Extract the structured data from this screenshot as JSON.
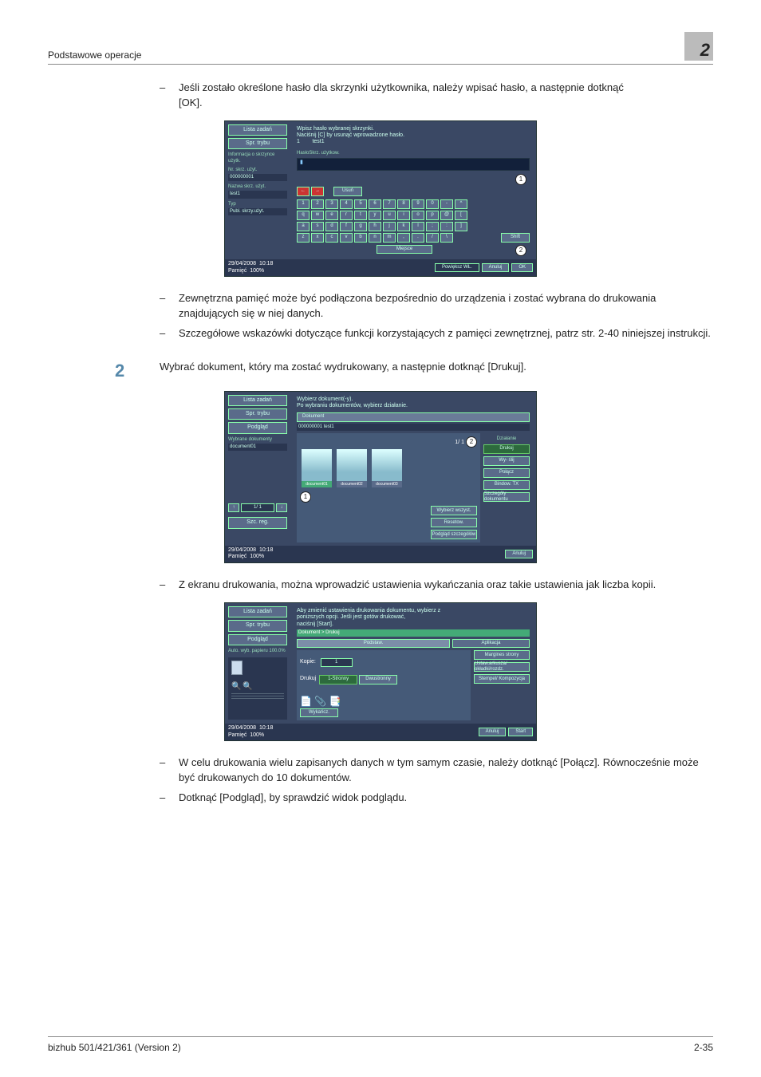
{
  "header": {
    "left": "Podstawowe operacje",
    "right": "2"
  },
  "footer": {
    "left": "bizhub 501/421/361 (Version 2)",
    "right": "2-35"
  },
  "p1_bullet1_a": "Jeśli zostało określone hasło dla skrzynki użytkownika, należy wpisać hasło, a następnie dotknąć",
  "p1_bullet1_b": "[OK].",
  "p1_bullet2": "Zewnętrzna pamięć może być podłączona bezpośrednio do urządzenia i zostać wybrana do drukowania znajdujących się w niej danych.",
  "p1_bullet3": "Szczegółowe wskazówki dotyczące funkcji korzystających z pamięci zewnętrznej, patrz str. 2-40 niniejszej instrukcji.",
  "step2_num": "2",
  "step2_text": "Wybrać dokument, który ma zostać wydrukowany, a następnie dotknąć [Drukuj].",
  "p2_bullet1": "Z ekranu drukowania, można wprowadzić ustawienia wykańczania oraz takie ustawienia jak liczba kopii.",
  "p3_bullet1": "W celu drukowania wielu zapisanych danych w tym samym czasie, należy dotknąć [Połącz]. Równocześnie może być drukowanych do 10 dokumentów.",
  "p3_bullet2": "Dotknąć [Podgląd], by sprawdzić widok podglądu.",
  "screen_common": {
    "tab_lista": "Lista zadań",
    "tab_spr": "Spr. trybu",
    "foot_date": "29/04/2008",
    "foot_time": "10:18",
    "foot_mem": "Pamięć",
    "foot_pct": "100%",
    "btn_anuluj": "Anuluj",
    "btn_ok": "OK",
    "btn_start": "Start"
  },
  "screen1": {
    "title1": "Wpisz hasło wybranej skrzynki.",
    "title2": "Naciśnij [C] by usunąć wprowadzone hasło.",
    "num": "1",
    "name": "test1",
    "lbl_haslo": "HasłoSkrz. użytkow.",
    "lbl_info": "Informacja o skrzynce użytk.",
    "lbl_nr": "Nr. skrz. użyt.",
    "val_nr": "000000001",
    "lbl_nazwa": "Nazwa skrz. użyt.",
    "val_nazwa": "test1",
    "lbl_typ": "Typ",
    "val_typ": "Publ. skrzy.użyt.",
    "btn_usun": "Usuń",
    "btn_miejsce": "Miejsce",
    "btn_shift": "Shift",
    "btn_powieksz": "Powiększ WŁ.",
    "kb_r1": [
      "1",
      "2",
      "3",
      "4",
      "5",
      "6",
      "7",
      "8",
      "9",
      "0",
      "-",
      "^"
    ],
    "kb_r2": [
      "q",
      "w",
      "e",
      "r",
      "t",
      "y",
      "u",
      "i",
      "o",
      "p",
      "@",
      "["
    ],
    "kb_r3": [
      "a",
      "s",
      "d",
      "f",
      "g",
      "h",
      "j",
      "k",
      "l",
      ";",
      ":",
      "]"
    ],
    "kb_r4": [
      "z",
      "x",
      "c",
      "v",
      "b",
      "n",
      "m",
      ",",
      ".",
      "/",
      "\\"
    ]
  },
  "screen2": {
    "title1": "Wybierz dokument(-y).",
    "title2": "Po wybraniu dokumentów, wybierz działanie.",
    "tab_podglad": "Podgląd",
    "lbl_wybrane": "Wybrane dokumenty",
    "val_wybrane": "document01",
    "tab_dokument": "Dokument",
    "crumb": "000000001   test1",
    "thumbs": [
      "document01",
      "document02",
      "document03"
    ],
    "page": "1/   1",
    "lbl_dzialanie": "Działanie",
    "btn_drukuj": "Drukuj",
    "btn_wyslij": "Wy- ślij",
    "btn_polacz": "Połącz",
    "btn_bindow": "Bindow. TX",
    "btn_wybierz": "Wybierz wszyst.",
    "btn_reset": "Resetow.",
    "btn_podsz": "Podgląd szczegółów",
    "btn_szcz": "Szczegóły dokumentu",
    "nav_page": "1/   1",
    "btn_szcreg": "Szc. reg."
  },
  "screen3": {
    "title1": "Aby zmienić ustawienia drukowania dokumentu, wybierz z",
    "title2": "poniższych opcji. Jeśli jest gotów drukować,",
    "title3": "naciśnij [Start].",
    "tab_podglad": "Podgląd",
    "crumb": "Dokument > Drukuj",
    "tab_podstaw": "Podstaw.",
    "tab_aplikacja": "Aplikacja",
    "lbl_auto": "Auto. wyb. papieru",
    "val_auto": "100.0%",
    "lbl_kopie": "Kopie:",
    "val_kopie": "1",
    "lbl_drukuj": "Drukuj",
    "btn_1str": "1-Stronny",
    "btn_dwu": "Dwustronny",
    "btn_wykancz": "Wykańcz.",
    "btn_margines": "Margines strony",
    "btn_ustaw": "Ustaw.arkusza/ okładki/rozdz.",
    "btn_stempel": "Stempel/ Kompozycja"
  }
}
